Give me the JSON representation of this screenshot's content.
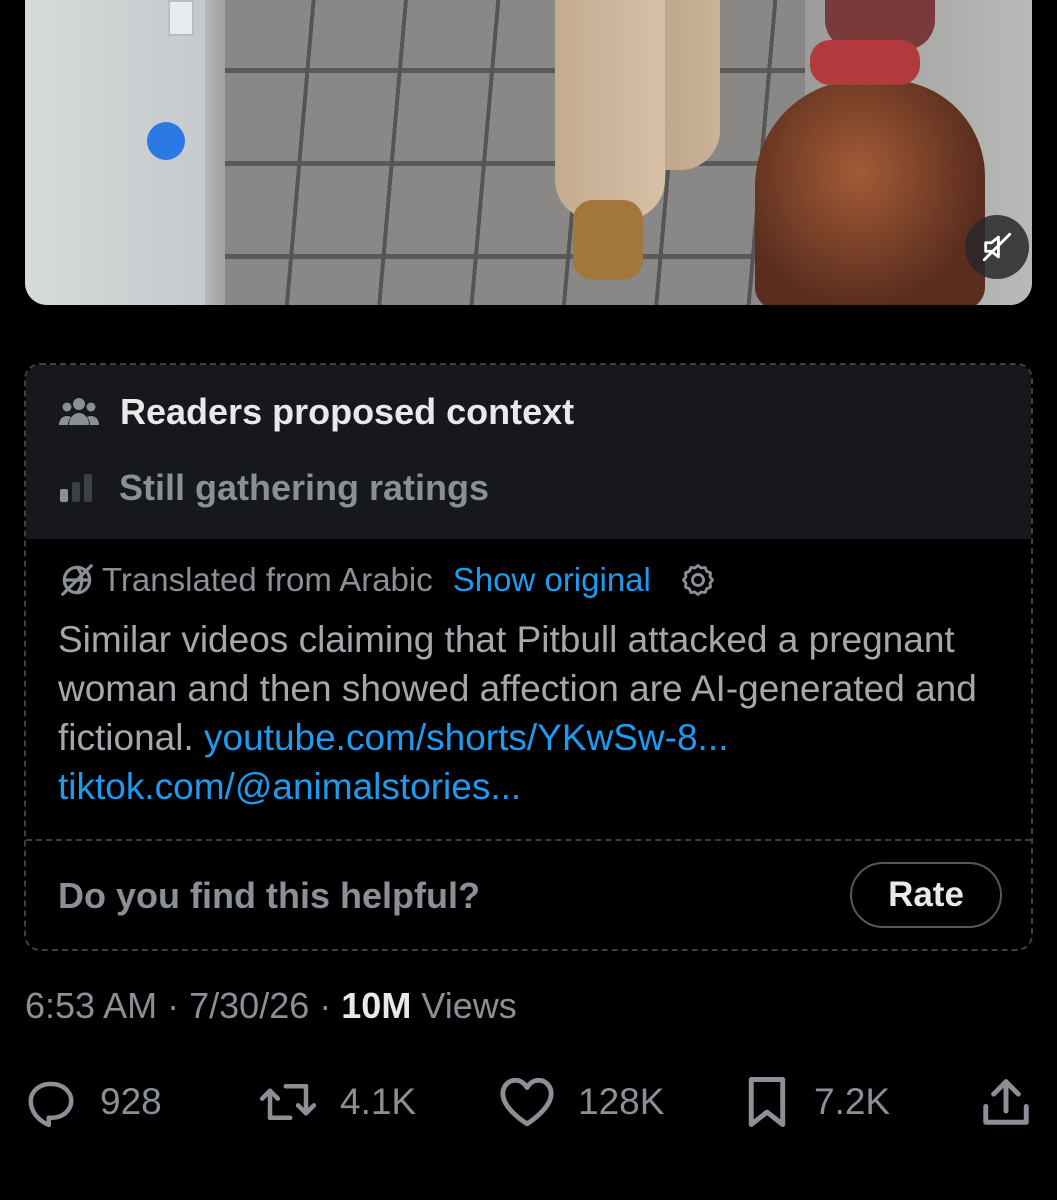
{
  "note": {
    "header_title": "Readers proposed context",
    "header_status": "Still gathering ratings",
    "translated_label": "Translated from Arabic",
    "show_original_label": "Show original",
    "body_text": "Similar videos claiming that Pitbull attacked a pregnant woman and then showed affection are AI-generated and fictional.",
    "link_1": "youtube.com/shorts/YKwSw-8...",
    "link_2": "tiktok.com/@animalstories...",
    "helpful_question": "Do you find this helpful?",
    "rate_label": "Rate"
  },
  "meta": {
    "time": "6:53 AM",
    "separator": "·",
    "date": "7/30/26",
    "views_count": "10M",
    "views_label": "Views"
  },
  "actions": {
    "replies": "928",
    "reposts": "4.1K",
    "likes": "128K",
    "bookmarks": "7.2K"
  },
  "colors": {
    "background": "#000000",
    "note_header_bg": "#16181c",
    "link": "#1d9bf0",
    "muted_text": "#8b9096",
    "primary_text": "#e7e9ea"
  },
  "icons": {
    "mute": "volume-muted-icon",
    "readers": "people-group-icon",
    "ratings": "bar-chart-icon",
    "translate": "globe-slash-icon",
    "settings": "gear-icon",
    "reply": "speech-bubble-icon",
    "repost": "repost-arrows-icon",
    "like": "heart-icon",
    "bookmark": "bookmark-icon",
    "share": "share-upload-icon"
  }
}
